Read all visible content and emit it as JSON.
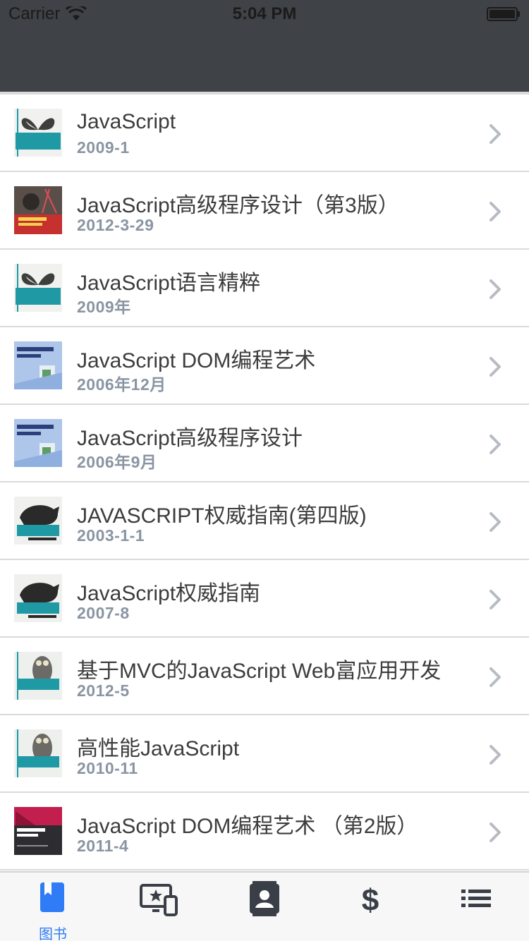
{
  "status": {
    "carrier": "Carrier",
    "time": "5:04 PM"
  },
  "books": [
    {
      "title": "JavaScript",
      "date": "2009-1",
      "cover": "book-cover-butterfly"
    },
    {
      "title": "JavaScript高级程序设计（第3版）",
      "date": "2012-3-29",
      "cover": "book-cover-red"
    },
    {
      "title": "JavaScript语言精粹",
      "date": "2009年",
      "cover": "book-cover-butterfly"
    },
    {
      "title": "JavaScript DOM编程艺术",
      "date": "2006年12月",
      "cover": "book-cover-blue"
    },
    {
      "title": "JavaScript高级程序设计",
      "date": "2006年9月",
      "cover": "book-cover-blue"
    },
    {
      "title": "JAVASCRIPT权威指南(第四版)",
      "date": "2003-1-1",
      "cover": "book-cover-rhino"
    },
    {
      "title": "JavaScript权威指南",
      "date": "2007-8",
      "cover": "book-cover-rhino"
    },
    {
      "title": "基于MVC的JavaScript Web富应用开发",
      "date": "2012-5",
      "cover": "book-cover-owl"
    },
    {
      "title": "高性能JavaScript",
      "date": "2010-11",
      "cover": "book-cover-owl"
    },
    {
      "title": "JavaScript DOM编程艺术 （第2版）",
      "date": "2011-4",
      "cover": "book-cover-dark"
    }
  ],
  "tabs": [
    {
      "label": "图书",
      "icon": "book-icon",
      "active": true
    },
    {
      "label": "",
      "icon": "media-devices-icon",
      "active": false
    },
    {
      "label": "",
      "icon": "contacts-icon",
      "active": false
    },
    {
      "label": "",
      "icon": "dollar-icon",
      "active": false
    },
    {
      "label": "",
      "icon": "list-icon",
      "active": false
    }
  ],
  "colors": {
    "accent": "#2f7cf6",
    "nav_bg": "#3f4246",
    "tab_icon": "#3a3f47"
  }
}
